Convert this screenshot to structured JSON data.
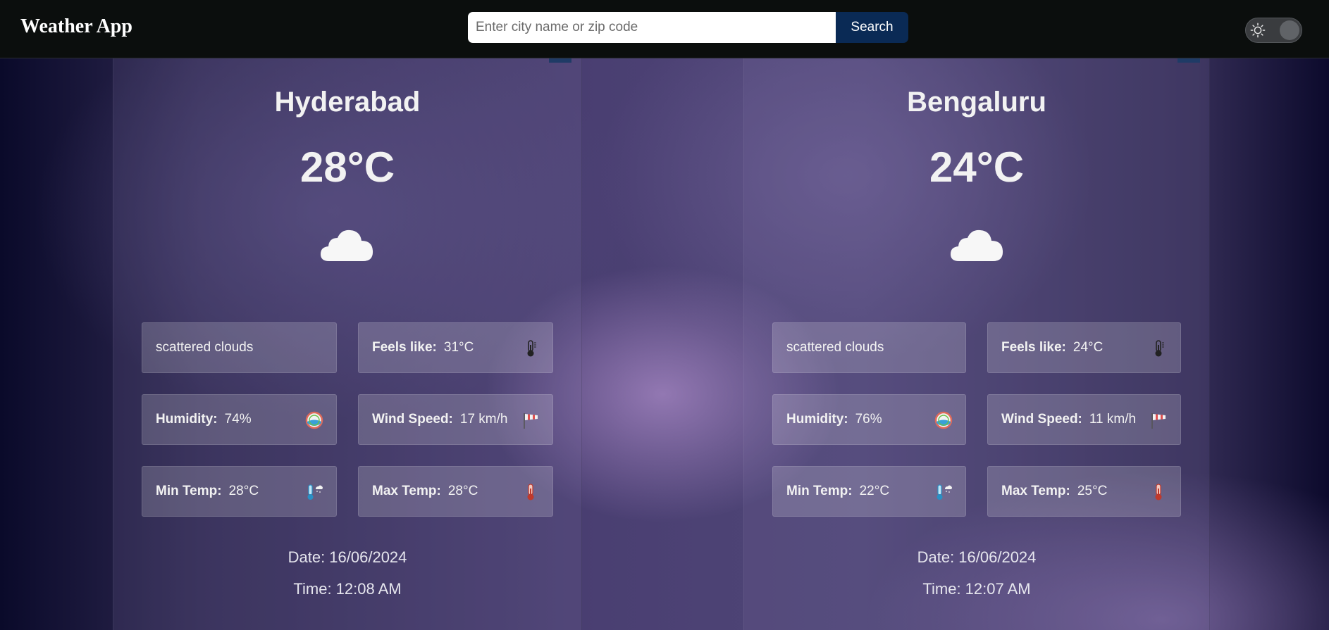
{
  "header": {
    "title": "Weather App",
    "search_placeholder": "Enter city name or zip code",
    "search_value": "",
    "search_button": "Search",
    "theme_toggle_icon": "sun-icon"
  },
  "cards": [
    {
      "city": "Hyderabad",
      "temperature": "28°C",
      "weather_icon": "cloud-icon",
      "description": "scattered clouds",
      "feels_like_label": "Feels like:",
      "feels_like": "31°C",
      "humidity_label": "Humidity:",
      "humidity": "74%",
      "wind_label": "Wind Speed:",
      "wind": "17 km/h",
      "min_label": "Min Temp:",
      "min": "28°C",
      "max_label": "Max Temp:",
      "max": "28°C",
      "date": "Date: 16/06/2024",
      "time": "Time: 12:08 AM"
    },
    {
      "city": "Bengaluru",
      "temperature": "24°C",
      "weather_icon": "cloud-icon",
      "description": "scattered clouds",
      "feels_like_label": "Feels like:",
      "feels_like": "24°C",
      "humidity_label": "Humidity:",
      "humidity": "76%",
      "wind_label": "Wind Speed:",
      "wind": "11 km/h",
      "min_label": "Min Temp:",
      "min": "22°C",
      "max_label": "Max Temp:",
      "max": "25°C",
      "date": "Date: 16/06/2024",
      "time": "Time: 12:07 AM"
    }
  ],
  "colors": {
    "navbar": "#0b0e0d",
    "search_button": "#0a2a55",
    "text": "#f2f2f2"
  }
}
